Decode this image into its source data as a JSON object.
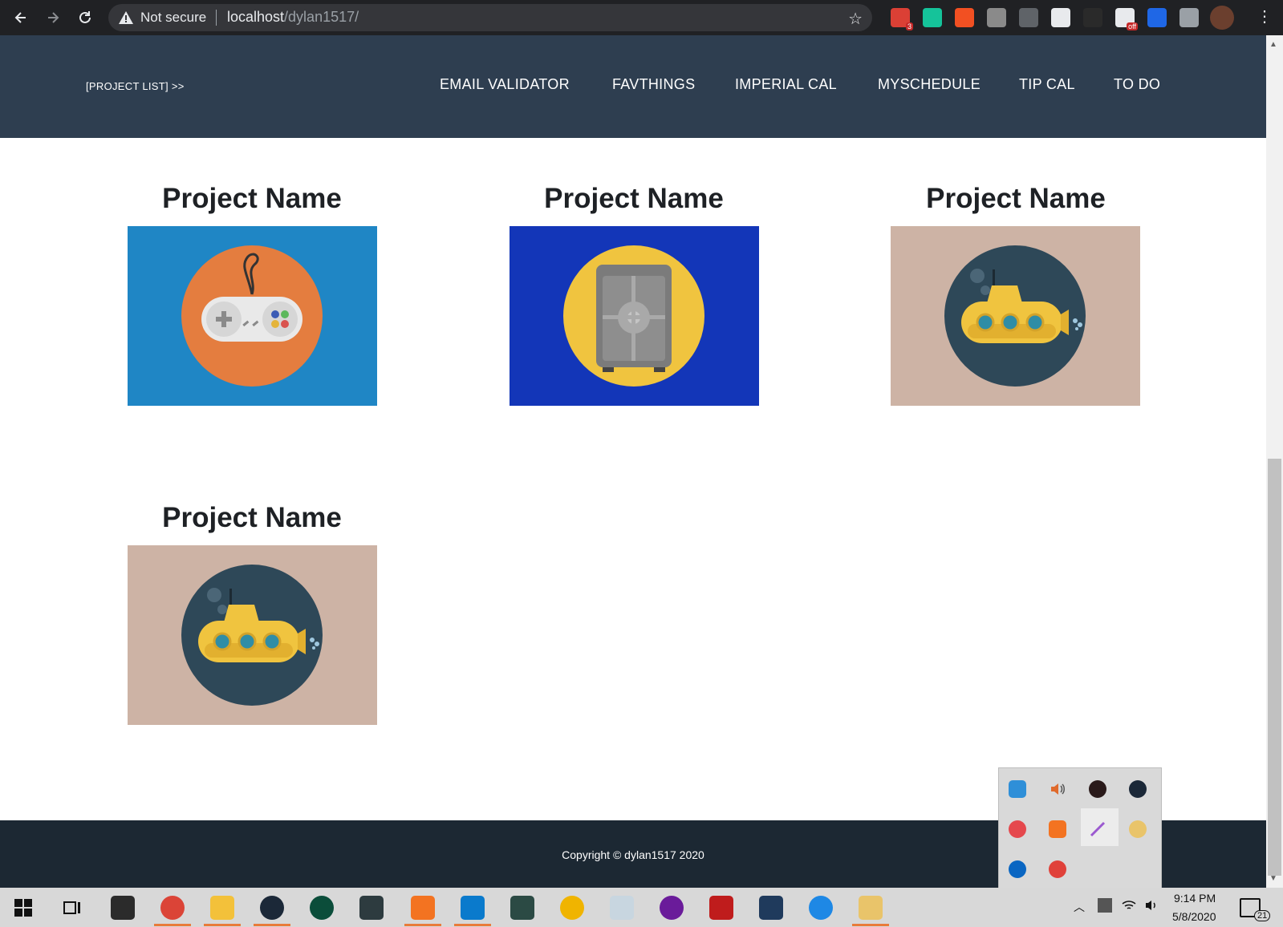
{
  "browser": {
    "security_label": "Not secure",
    "url_host": "localhost",
    "url_path": "/dylan1517/",
    "extensions": [
      {
        "name": "todoist-extension",
        "color": "#db4035",
        "badge": "3"
      },
      {
        "name": "grammarly-extension",
        "color": "#15c39a"
      },
      {
        "name": "microsoft-extension",
        "color": "#f25022"
      },
      {
        "name": "refresh-extension",
        "color": "#8a8a8a"
      },
      {
        "name": "settings-extension",
        "color": "#5f6368"
      },
      {
        "name": "amazon-extension",
        "color": "#e8eaed"
      },
      {
        "name": "ghostery-extension",
        "color": "#2a2a2a"
      },
      {
        "name": "timer-extension",
        "color": "#e8eaed",
        "badge": "off"
      },
      {
        "name": "malwarebytes-extension",
        "color": "#1f67e6"
      },
      {
        "name": "cs-extension",
        "color": "#9aa0a6"
      }
    ]
  },
  "header": {
    "brand": "[PROJECT LIST] >>",
    "menu": [
      "EMAIL VALIDATOR",
      "FAVTHINGS",
      "IMPERIAL CAL",
      "MYSCHEDULE",
      "TIP CAL",
      "TO DO"
    ]
  },
  "projects": [
    {
      "title": "Project Name",
      "icon": "gamepad-icon",
      "bg": "#1f86c5",
      "circle": "#e47d3f"
    },
    {
      "title": "Project Name",
      "icon": "safe-icon",
      "bg": "#1336b8",
      "circle": "#f0c43f"
    },
    {
      "title": "Project Name",
      "icon": "submarine-icon",
      "bg": "#cdb3a5",
      "circle": "#2e4858"
    },
    {
      "title": "Project Name",
      "icon": "submarine-icon",
      "bg": "#cdb3a5",
      "circle": "#2e4858"
    }
  ],
  "footer": {
    "copyright": "Copyright © dylan1517 2020"
  },
  "taskbar": {
    "time": "9:14 PM",
    "date": "5/8/2020",
    "notification_count": "21"
  }
}
